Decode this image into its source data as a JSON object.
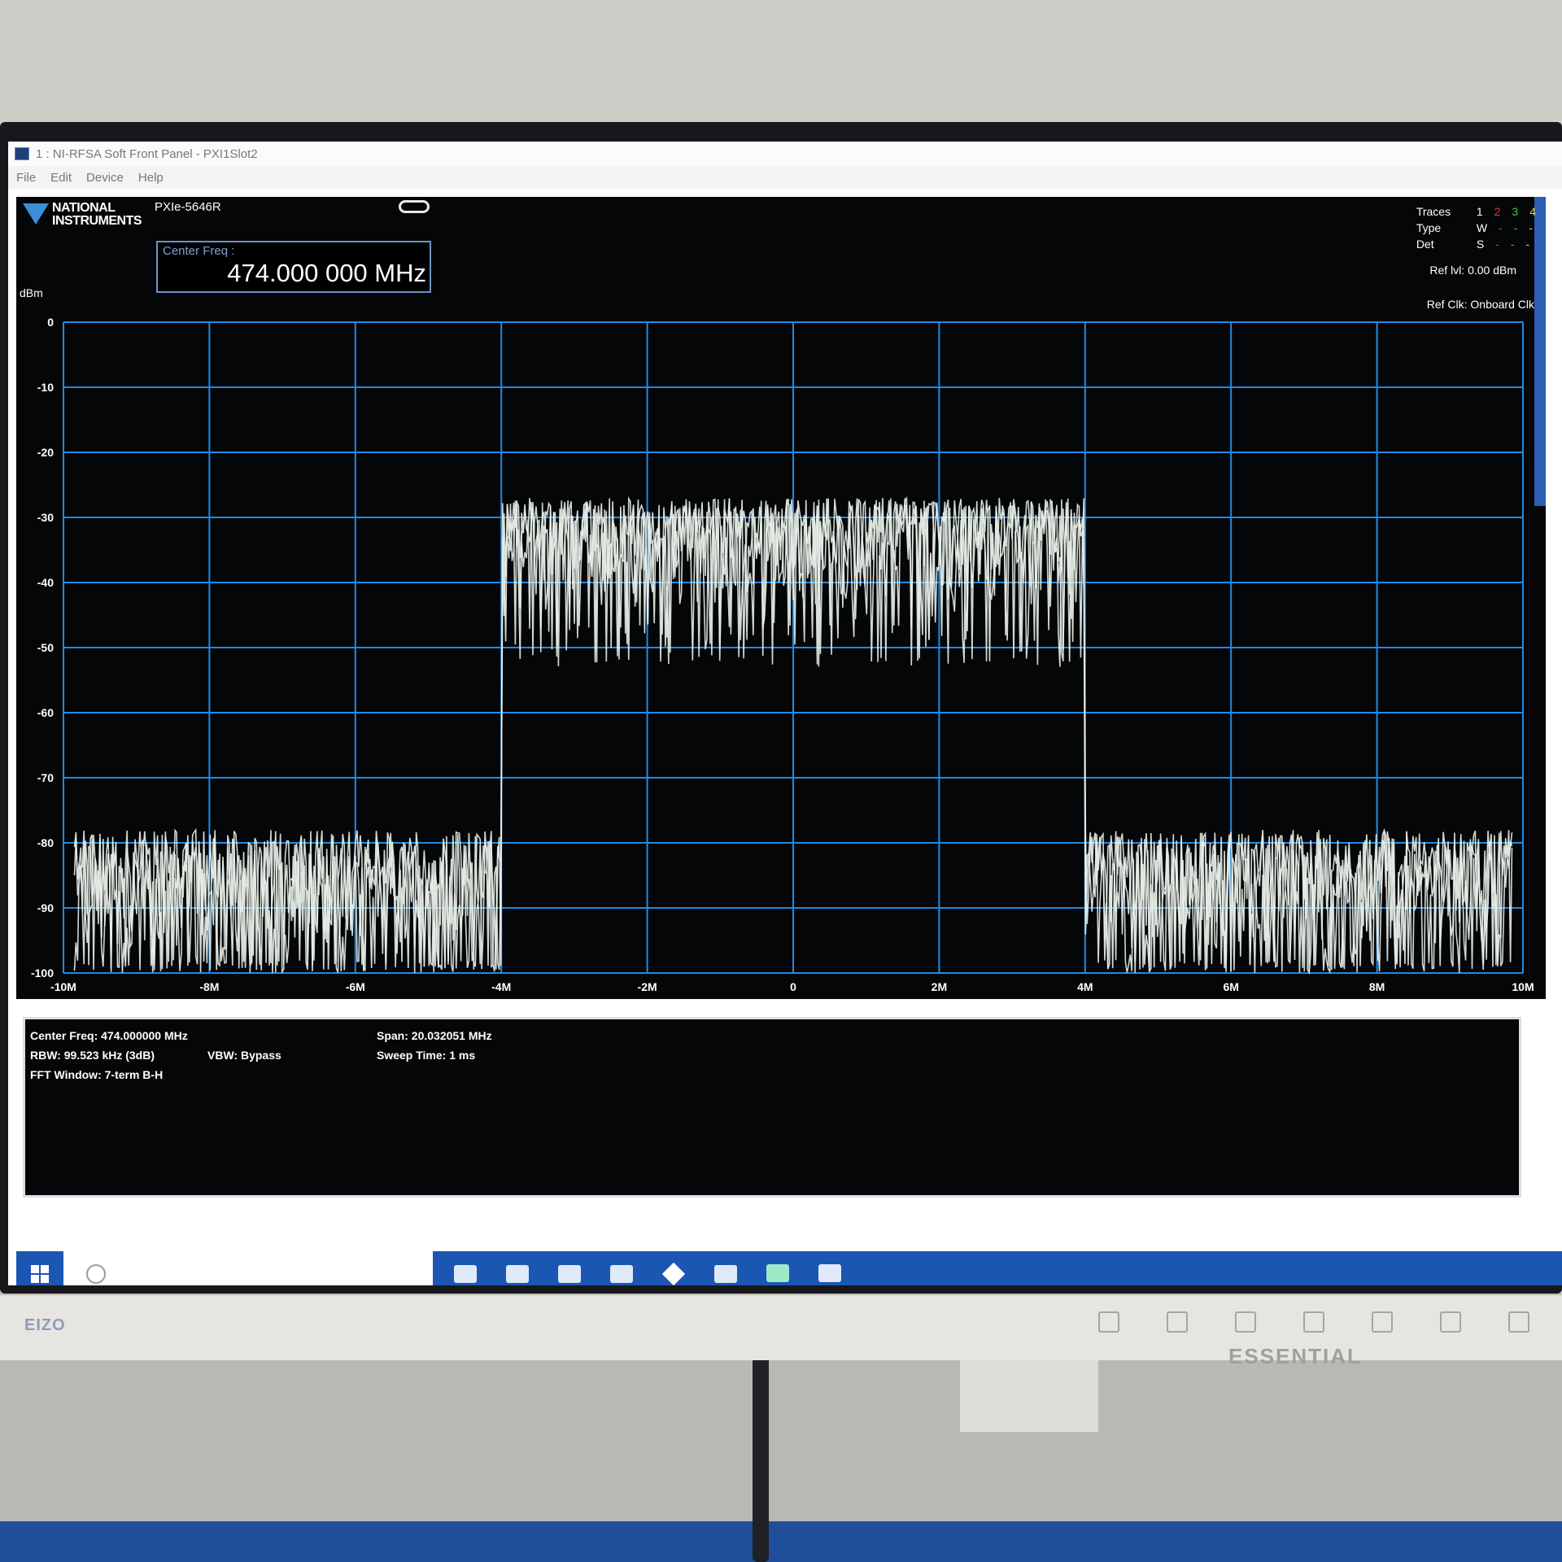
{
  "window": {
    "title": "1 : NI-RFSA Soft Front Panel - PXI1Slot2",
    "menu": [
      "File",
      "Edit",
      "Device",
      "Help"
    ]
  },
  "header": {
    "logo_line1": "NATIONAL",
    "logo_line2": "INSTRUMENTS",
    "device": "PXIe-5646R",
    "center_freq_label": "Center Freq :",
    "center_freq_value": "474.000 000 MHz"
  },
  "traces": {
    "label_traces": "Traces",
    "label_type": "Type",
    "label_det": "Det",
    "numbers": [
      "1",
      "2",
      "3",
      "4"
    ],
    "number_colors": [
      "#ffffff",
      "#e03c31",
      "#35c94a",
      "#e6d53a"
    ],
    "type": [
      "W",
      "-",
      "-",
      "-"
    ],
    "det": [
      "S",
      "-",
      "-",
      "-"
    ],
    "ref_level": "Ref lvl: 0.00 dBm",
    "ref_clock": "Ref Clk: Onboard Clk"
  },
  "chart_data": {
    "type": "line",
    "ylabel": "dBm",
    "ylim": [
      -100,
      0
    ],
    "yticks": [
      "0",
      "-10",
      "-20",
      "-30",
      "-40",
      "-50",
      "-60",
      "-70",
      "-80",
      "-90",
      "-100"
    ],
    "xlim": [
      -10,
      10
    ],
    "x_unit": "MHz",
    "xticks": [
      "-10M",
      "-8M",
      "-6M",
      "-4M",
      "-2M",
      "0",
      "2M",
      "4M",
      "6M",
      "8M",
      "10M"
    ],
    "grid": true,
    "band_edges_mhz": [
      -4,
      4
    ],
    "in_band_level_dbm": [
      -45,
      -27
    ],
    "out_of_band_level_dbm": [
      -98,
      -78
    ],
    "trace_color": "#e8eee8",
    "grid_color": "#1e8ce6"
  },
  "measurements": {
    "center_freq": "Center Freq: 474.000000 MHz",
    "span": "Span: 20.032051 MHz",
    "rbw": "RBW: 99.523 kHz (3dB)",
    "vbw": "VBW: Bypass",
    "sweep_time": "Sweep Time: 1 ms",
    "fft_window": "FFT Window: 7-term B-H"
  },
  "monitor": {
    "brand": "EIZO",
    "model": "ESSENTIAL"
  }
}
